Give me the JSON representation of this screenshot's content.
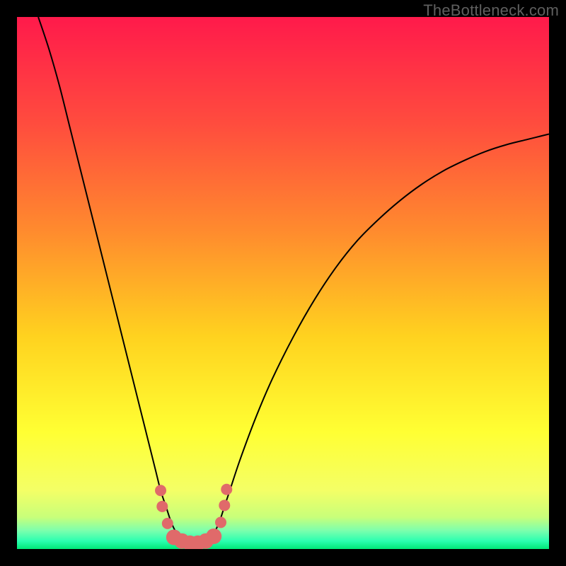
{
  "watermark": "TheBottleneck.com",
  "chart_data": {
    "type": "line",
    "title": "",
    "xlabel": "",
    "ylabel": "",
    "xlim": [
      0,
      100
    ],
    "ylim": [
      0,
      100
    ],
    "grid": false,
    "legend": false,
    "background_gradient_stops": [
      {
        "offset": 0.0,
        "color": "#ff1a4b"
      },
      {
        "offset": 0.2,
        "color": "#ff4c3e"
      },
      {
        "offset": 0.4,
        "color": "#ff8a2e"
      },
      {
        "offset": 0.6,
        "color": "#ffd21f"
      },
      {
        "offset": 0.78,
        "color": "#ffff33"
      },
      {
        "offset": 0.89,
        "color": "#f4ff66"
      },
      {
        "offset": 0.94,
        "color": "#c8ff7a"
      },
      {
        "offset": 0.965,
        "color": "#7dffad"
      },
      {
        "offset": 0.985,
        "color": "#2bffb0"
      },
      {
        "offset": 1.0,
        "color": "#00e878"
      }
    ],
    "series": [
      {
        "name": "curve",
        "stroke": "#000000",
        "stroke_width": 2,
        "x": [
          4,
          6,
          8,
          10,
          12,
          14,
          16,
          18,
          20,
          22,
          24,
          26,
          27,
          28,
          29,
          30,
          31,
          32,
          33,
          34,
          35,
          36,
          37,
          38,
          39,
          40,
          42,
          45,
          48,
          52,
          56,
          60,
          64,
          68,
          72,
          76,
          80,
          84,
          88,
          92,
          96,
          100
        ],
        "y": [
          100,
          94,
          87,
          79,
          71,
          63,
          55,
          47,
          39,
          31,
          23,
          15,
          11,
          8,
          5,
          3,
          2,
          1.5,
          1.3,
          1.3,
          1.5,
          2,
          3,
          5,
          8,
          11,
          17,
          25,
          32,
          40,
          47,
          53,
          58,
          62,
          65.5,
          68.5,
          71,
          73,
          74.7,
          76,
          77,
          78
        ]
      }
    ],
    "markers": {
      "color": "#e06a6a",
      "radius_small": 8,
      "radius_large": 11,
      "points": [
        {
          "x": 27.0,
          "y": 11.0,
          "r": "small"
        },
        {
          "x": 27.3,
          "y": 8.0,
          "r": "small"
        },
        {
          "x": 28.3,
          "y": 4.8,
          "r": "small"
        },
        {
          "x": 29.5,
          "y": 2.2,
          "r": "large"
        },
        {
          "x": 31.0,
          "y": 1.5,
          "r": "large"
        },
        {
          "x": 32.5,
          "y": 1.1,
          "r": "large"
        },
        {
          "x": 34.0,
          "y": 1.1,
          "r": "large"
        },
        {
          "x": 35.5,
          "y": 1.5,
          "r": "large"
        },
        {
          "x": 37.0,
          "y": 2.4,
          "r": "large"
        },
        {
          "x": 38.3,
          "y": 5.0,
          "r": "small"
        },
        {
          "x": 39.0,
          "y": 8.2,
          "r": "small"
        },
        {
          "x": 39.4,
          "y": 11.2,
          "r": "small"
        }
      ]
    }
  }
}
